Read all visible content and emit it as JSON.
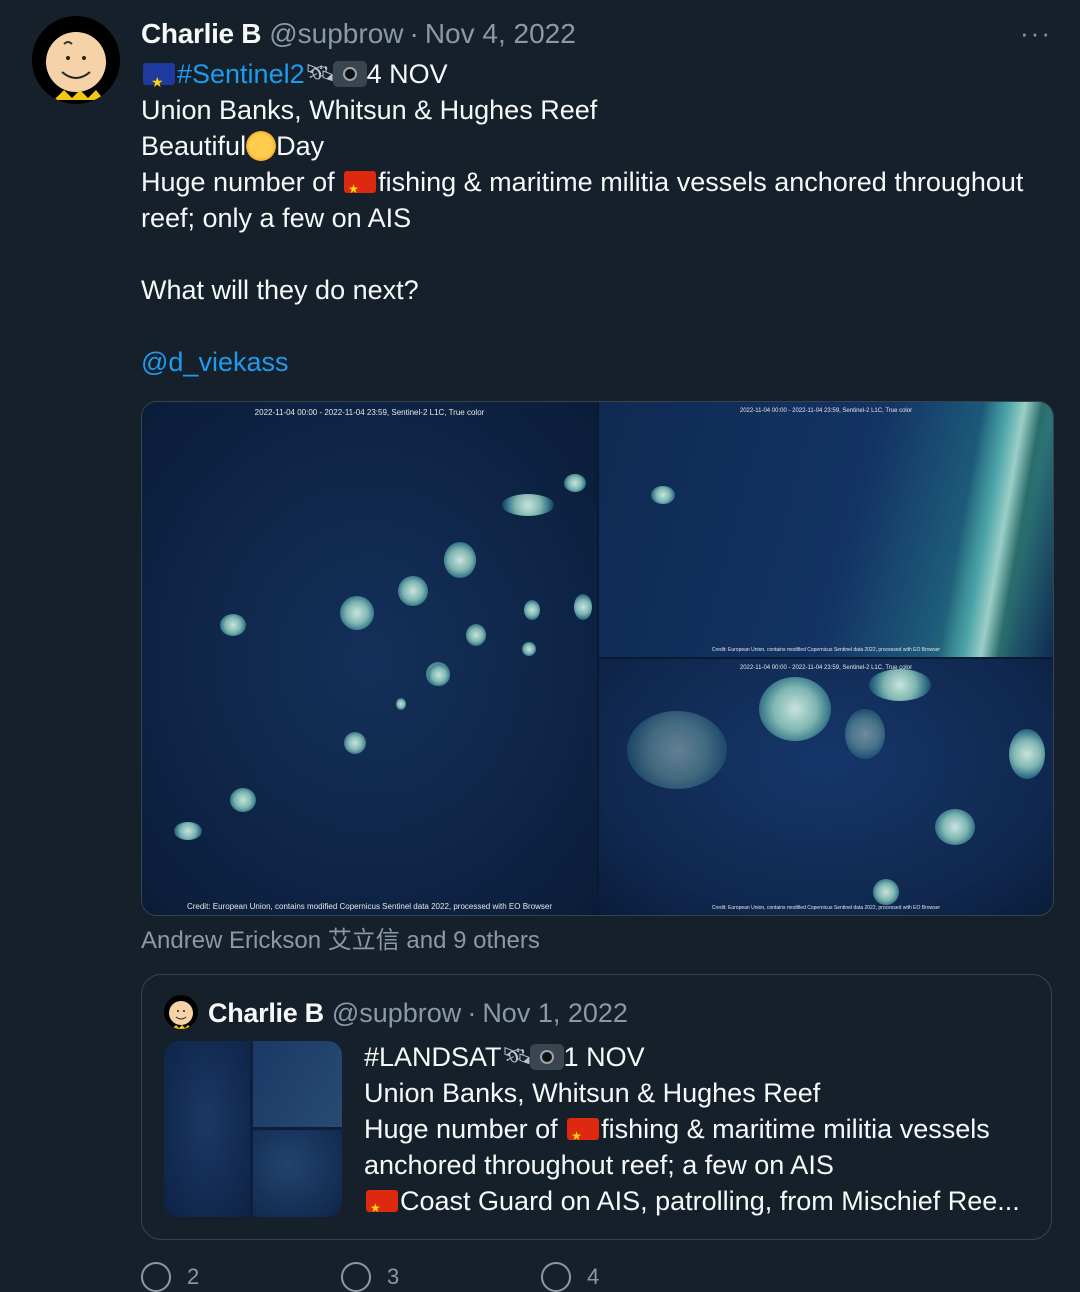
{
  "tweet": {
    "name": "Charlie B",
    "handle": "@supbrow",
    "separator": "·",
    "date": "Nov 4, 2022",
    "more": "···",
    "hashtag": "#Sentinel2",
    "date_tag": "4 NOV",
    "line2": "Union Banks, Whitsun & Hughes Reef",
    "line3_a": "Beautiful",
    "line3_b": "Day",
    "line4_a": "Huge number of ",
    "line4_b": "fishing & maritime militia vessels anchored throughout",
    "line5": "reef; only a few on AIS",
    "line6": "What will they do next?",
    "mention": "@d_viekass",
    "icons": [
      "eu-flag-icon",
      "satellite-icon",
      "camera-icon",
      "sun-icon",
      "china-flag-icon"
    ]
  },
  "media": {
    "left_caption": "2022-11-04 00:00 - 2022-11-04 23:59, Sentinel-2 L1C, True color",
    "left_credit": "Credit: European Union, contains modified Copernicus Sentinel data 2022, processed with EO Browser",
    "tr_caption": "2022-11-04 00:00 - 2022-11-04 23:59, Sentinel-2 L1C, True color",
    "tr_credit": "Credit: European Union, contains modified Copernicus Sentinel data 2022, processed with EO Browser",
    "br_caption": "2022-11-04 00:00 - 2022-11-04 23:59, Sentinel-2 L1C, True color",
    "br_credit": "Credit: European Union, contains modified Copernicus Sentinel data 2022, processed with EO Browser"
  },
  "likes_line": "Andrew Erickson 艾立信 and 9 others",
  "quote": {
    "name": "Charlie B",
    "handle": "@supbrow",
    "separator": "·",
    "date": "Nov 1, 2022",
    "hashtag": "#LANDSAT",
    "date_tag": "1 NOV",
    "line2": "Union Banks, Whitsun & Hughes Reef",
    "line3_a": "Huge number of ",
    "line3_b": "fishing & maritime militia vessels",
    "line4": "anchored throughout reef; a few on AIS",
    "line5": "Coast Guard on AIS, patrolling, from Mischief Ree..."
  },
  "actions": {
    "replies": "2",
    "retweets": "3",
    "likes": "4"
  }
}
